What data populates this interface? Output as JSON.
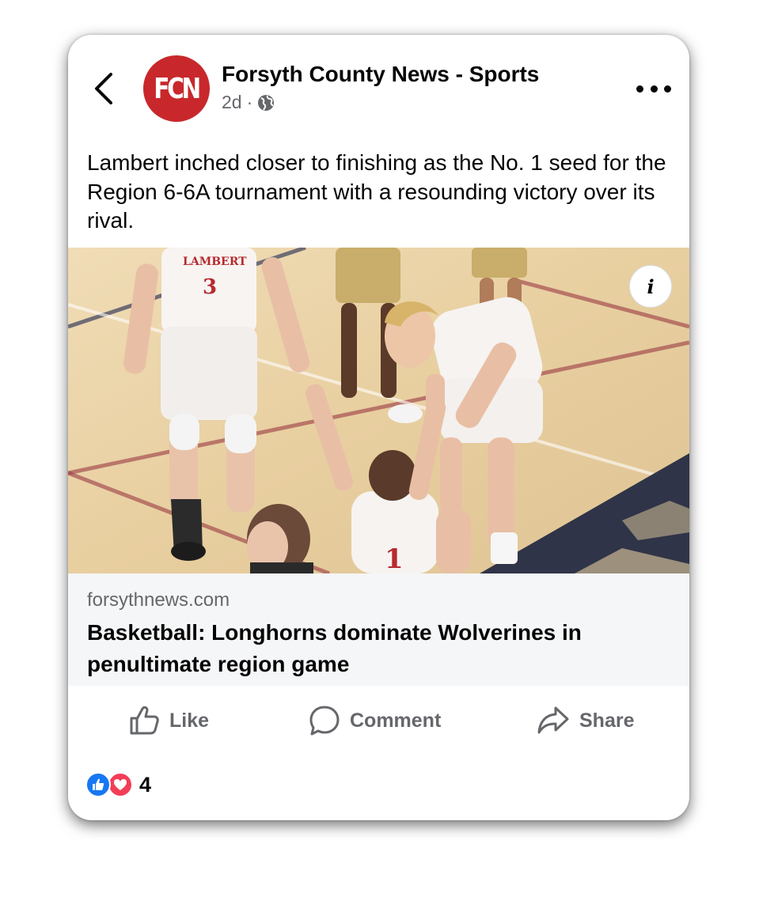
{
  "header": {
    "avatar_text": "FCN",
    "page_name": "Forsyth County News - Sports",
    "time": "2d",
    "separator": "·",
    "privacy_icon": "globe-icon"
  },
  "post": {
    "text": "Lambert inched closer to finishing as the No. 1 seed for the Region 6-6A tournament with a resounding victory over its rival."
  },
  "photo": {
    "info_label": "i",
    "jersey_text": "LAMBERT",
    "jersey_numbers": [
      "3",
      "1"
    ]
  },
  "link_preview": {
    "domain": "forsythnews.com",
    "title": "Basketball: Longhorns dominate Wolverines in penultimate region game"
  },
  "actions": {
    "like": "Like",
    "comment": "Comment",
    "share": "Share"
  },
  "reactions": {
    "count": "4"
  },
  "colors": {
    "brand_red": "#c8282b",
    "like_blue": "#1877f2",
    "love_red": "#f33e58",
    "secondary_text": "#65676b"
  }
}
